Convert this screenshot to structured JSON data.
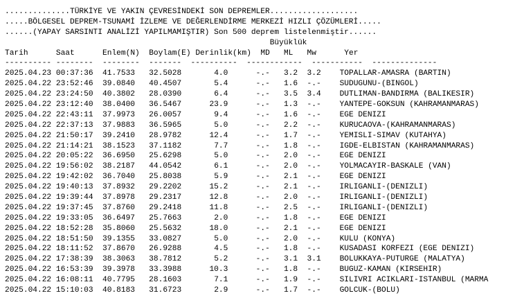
{
  "header": {
    "line1": "..............TÜRKİYE VE YAKIN ÇEVRESİNDEKİ SON DEPREMLER...................",
    "line2": ".....BÖLGESEL DEPREM-TSUNAMİ İZLEME VE DEĞERLENDİRME MERKEZİ HIZLI ÇÖZÜMLERİ.....",
    "line3": "......(YAPAY SARSINTI ANALİZİ YAPILMAMIŞTIR) Son 500 deprem listelenmiştir......"
  },
  "columns": {
    "magnitude_group": "Büyüklük",
    "date": "Tarih",
    "time": "Saat",
    "latitude": "Enlem(N)",
    "longitude": "Boylam(E)",
    "depth": "Derinlik(km)",
    "md": "MD",
    "ml": "ML",
    "mw": "Mw",
    "location": "Yer"
  },
  "separator": "---------- --------  --------  -------  ----------  ------------  -----------  --------------",
  "rows": [
    {
      "date": "2025.04.23",
      "time": "00:37:36",
      "lat": "41.7533",
      "lon": "32.5028",
      "depth": "4.0",
      "md": "-.-",
      "ml": "3.2",
      "mw": "3.2",
      "location": "TOPALLAR-AMASRA (BARTIN)"
    },
    {
      "date": "2025.04.22",
      "time": "23:52:46",
      "lat": "39.0840",
      "lon": "40.4507",
      "depth": "5.4",
      "md": "-.-",
      "ml": "1.6",
      "mw": "-.-",
      "location": "SUDUGUNU-(BINGOL)"
    },
    {
      "date": "2025.04.22",
      "time": "23:24:50",
      "lat": "40.3802",
      "lon": "28.0390",
      "depth": "6.4",
      "md": "-.-",
      "ml": "3.5",
      "mw": "3.4",
      "location": "DUTLIMAN-BANDIRMA (BALIKESIR)"
    },
    {
      "date": "2025.04.22",
      "time": "23:12:40",
      "lat": "38.0400",
      "lon": "36.5467",
      "depth": "23.9",
      "md": "-.-",
      "ml": "1.3",
      "mw": "-.-",
      "location": "YANTEPE-GOKSUN (KAHRAMANMARAS)"
    },
    {
      "date": "2025.04.22",
      "time": "22:43:11",
      "lat": "37.9973",
      "lon": "26.0057",
      "depth": "9.4",
      "md": "-.-",
      "ml": "1.6",
      "mw": "-.-",
      "location": "EGE DENIZI"
    },
    {
      "date": "2025.04.22",
      "time": "22:37:13",
      "lat": "37.9883",
      "lon": "36.5965",
      "depth": "5.0",
      "md": "-.-",
      "ml": "2.2",
      "mw": "-.-",
      "location": "KURUCAOVA-(KAHRAMANMARAS)"
    },
    {
      "date": "2025.04.22",
      "time": "21:50:17",
      "lat": "39.2410",
      "lon": "28.9782",
      "depth": "12.4",
      "md": "-.-",
      "ml": "1.7",
      "mw": "-.-",
      "location": "YEMISLI-SIMAV (KUTAHYA)"
    },
    {
      "date": "2025.04.22",
      "time": "21:14:21",
      "lat": "38.1523",
      "lon": "37.1182",
      "depth": "7.7",
      "md": "-.-",
      "ml": "1.8",
      "mw": "-.-",
      "location": "IGDE-ELBISTAN (KAHRAMANMARAS)"
    },
    {
      "date": "2025.04.22",
      "time": "20:05:22",
      "lat": "36.6950",
      "lon": "25.6298",
      "depth": "5.0",
      "md": "-.-",
      "ml": "2.0",
      "mw": "-.-",
      "location": "EGE DENIZI"
    },
    {
      "date": "2025.04.22",
      "time": "19:56:02",
      "lat": "38.2187",
      "lon": "44.0542",
      "depth": "6.1",
      "md": "-.-",
      "ml": "2.0",
      "mw": "-.-",
      "location": "YOLMACAYIR-BASKALE (VAN)"
    },
    {
      "date": "2025.04.22",
      "time": "19:42:02",
      "lat": "36.7040",
      "lon": "25.8038",
      "depth": "5.9",
      "md": "-.-",
      "ml": "2.1",
      "mw": "-.-",
      "location": "EGE DENIZI"
    },
    {
      "date": "2025.04.22",
      "time": "19:40:13",
      "lat": "37.8932",
      "lon": "29.2202",
      "depth": "15.2",
      "md": "-.-",
      "ml": "2.1",
      "mw": "-.-",
      "location": "IRLIGANLI-(DENIZLI)"
    },
    {
      "date": "2025.04.22",
      "time": "19:39:44",
      "lat": "37.8978",
      "lon": "29.2317",
      "depth": "12.8",
      "md": "-.-",
      "ml": "2.0",
      "mw": "-.-",
      "location": "IRLIGANLI-(DENIZLI)"
    },
    {
      "date": "2025.04.22",
      "time": "19:37:45",
      "lat": "37.8760",
      "lon": "29.2418",
      "depth": "11.8",
      "md": "-.-",
      "ml": "2.5",
      "mw": "-.-",
      "location": "IRLIGANLI-(DENIZLI)"
    },
    {
      "date": "2025.04.22",
      "time": "19:33:05",
      "lat": "36.6497",
      "lon": "25.7663",
      "depth": "2.0",
      "md": "-.-",
      "ml": "1.8",
      "mw": "-.-",
      "location": "EGE DENIZI"
    },
    {
      "date": "2025.04.22",
      "time": "18:52:28",
      "lat": "35.8060",
      "lon": "25.5632",
      "depth": "18.0",
      "md": "-.-",
      "ml": "2.1",
      "mw": "-.-",
      "location": "EGE DENIZI"
    },
    {
      "date": "2025.04.22",
      "time": "18:51:50",
      "lat": "39.1355",
      "lon": "33.0827",
      "depth": "5.0",
      "md": "-.-",
      "ml": "2.0",
      "mw": "-.-",
      "location": "KULU (KONYA)"
    },
    {
      "date": "2025.04.22",
      "time": "18:11:52",
      "lat": "37.8670",
      "lon": "26.9288",
      "depth": "4.5",
      "md": "-.-",
      "ml": "1.8",
      "mw": "-.-",
      "location": "KUSADASI KORFEZI (EGE DENIZI)"
    },
    {
      "date": "2025.04.22",
      "time": "17:38:39",
      "lat": "38.3063",
      "lon": "38.7812",
      "depth": "5.2",
      "md": "-.-",
      "ml": "3.1",
      "mw": "3.1",
      "location": "BOLUKKAYA-PUTURGE (MALATYA)"
    },
    {
      "date": "2025.04.22",
      "time": "16:53:39",
      "lat": "39.3978",
      "lon": "33.3988",
      "depth": "10.3",
      "md": "-.-",
      "ml": "1.8",
      "mw": "-.-",
      "location": "BUGUZ-KAMAN (KIRSEHIR)"
    },
    {
      "date": "2025.04.22",
      "time": "16:08:11",
      "lat": "40.7795",
      "lon": "28.1603",
      "depth": "7.1",
      "md": "-.-",
      "ml": "1.9",
      "mw": "-.-",
      "location": "SILIVRI ACIKLARI-ISTANBUL (MARMA"
    },
    {
      "date": "2025.04.22",
      "time": "15:10:03",
      "lat": "40.8183",
      "lon": "31.6723",
      "depth": "2.9",
      "md": "-.-",
      "ml": "1.7",
      "mw": "-.-",
      "location": "GOLCUK-(BOLU)"
    }
  ]
}
